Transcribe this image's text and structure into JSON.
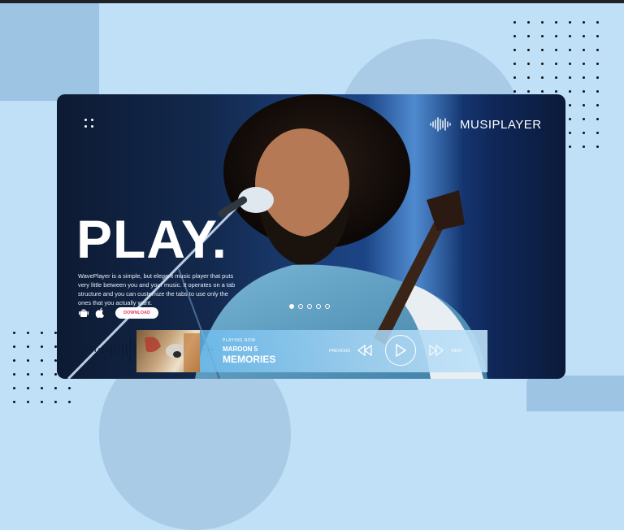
{
  "brand": {
    "name": "MUSIPLAYER"
  },
  "hero": {
    "headline": "PLAY.",
    "description": "WavePlayer is a simple, but elegant music player that puts very little between you and your music. It operates on a tab structure and you can customize the tabs to use only the ones that you actually want.",
    "download_label": "DOWNLOAD",
    "slides_total": 5,
    "slide_active": 1
  },
  "player": {
    "now_playing_label": "PLAYING NOW",
    "artist": "MAROON 5",
    "song": "MEMORIES",
    "previous_label": "PREVIOUS",
    "next_label": "NEXT"
  },
  "icons": {
    "menu": "grid-dots-icon",
    "brand": "soundwave-icon",
    "android": "android-icon",
    "apple": "apple-icon",
    "previous": "rewind-icon",
    "play": "play-icon",
    "next": "fast-forward-icon"
  },
  "colors": {
    "background": "#bfe0f7",
    "accent": "#e03a6a",
    "hero_dark": "#0d1a33"
  }
}
